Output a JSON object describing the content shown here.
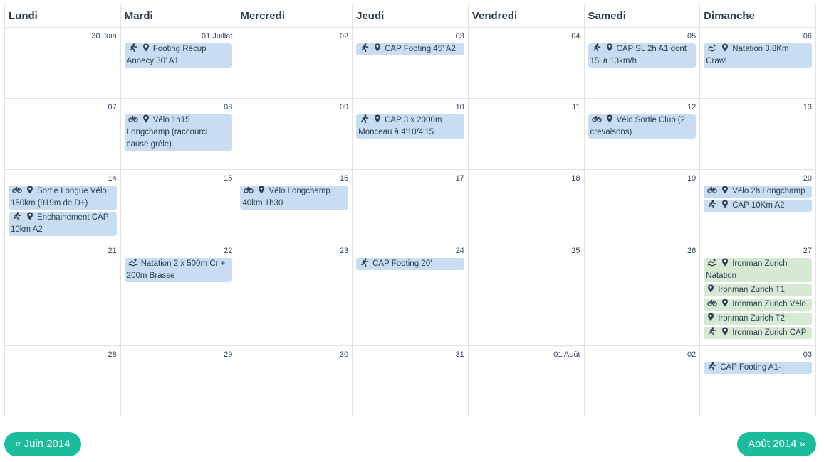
{
  "weekdays": [
    "Lundi",
    "Mardi",
    "Mercredi",
    "Jeudi",
    "Vendredi",
    "Samedi",
    "Dimanche"
  ],
  "weeks": [
    {
      "height": 100,
      "days": [
        {
          "num": "30 Juin",
          "events": []
        },
        {
          "num": "01 Juillet",
          "events": [
            {
              "icon": "run",
              "pin": true,
              "text": "Footing Récup Annecy 30' A1"
            }
          ]
        },
        {
          "num": "02",
          "events": []
        },
        {
          "num": "03",
          "events": [
            {
              "icon": "run",
              "pin": true,
              "text": "CAP Footing 45' A2"
            }
          ]
        },
        {
          "num": "04",
          "events": []
        },
        {
          "num": "05",
          "events": [
            {
              "icon": "run",
              "pin": true,
              "text": "CAP SL 2h A1 dont 15' à 13km/h"
            }
          ]
        },
        {
          "num": "06",
          "events": [
            {
              "icon": "swim",
              "pin": true,
              "text": "Natation 3,8Km Crawl"
            }
          ]
        }
      ]
    },
    {
      "height": 100,
      "days": [
        {
          "num": "07",
          "events": []
        },
        {
          "num": "08",
          "events": [
            {
              "icon": "bike",
              "pin": true,
              "text": "Vélo 1h15 Longchamp (raccourci cause grêle)"
            }
          ]
        },
        {
          "num": "09",
          "events": []
        },
        {
          "num": "10",
          "events": [
            {
              "icon": "run",
              "pin": true,
              "text": "CAP 3 x 2000m Monceau à 4'10/4'15"
            }
          ]
        },
        {
          "num": "11",
          "events": []
        },
        {
          "num": "12",
          "events": [
            {
              "icon": "bike",
              "pin": true,
              "text": "Vélo Sortie Club (2 crevaisons)"
            }
          ]
        },
        {
          "num": "13",
          "events": []
        }
      ]
    },
    {
      "height": 102,
      "days": [
        {
          "num": "14",
          "events": [
            {
              "icon": "bike",
              "pin": true,
              "text": "Sortie Longue Vélo 150km (919m de D+)"
            },
            {
              "icon": "run",
              "pin": true,
              "text": "Enchainement CAP 10km A2"
            }
          ]
        },
        {
          "num": "15",
          "events": []
        },
        {
          "num": "16",
          "events": [
            {
              "icon": "bike",
              "pin": true,
              "text": "Vélo Longchamp 40km 1h30"
            }
          ]
        },
        {
          "num": "17",
          "events": []
        },
        {
          "num": "18",
          "events": []
        },
        {
          "num": "19",
          "events": []
        },
        {
          "num": "20",
          "events": [
            {
              "icon": "bike",
              "pin": true,
              "text": "Vélo 2h Longchamp"
            },
            {
              "icon": "run",
              "pin": true,
              "text": "CAP 10Km A2"
            }
          ]
        }
      ]
    },
    {
      "height": 146,
      "days": [
        {
          "num": "21",
          "events": []
        },
        {
          "num": "22",
          "events": [
            {
              "icon": "swim",
              "pin": false,
              "text": "Natation 2 x 500m Cr + 200m Brasse"
            }
          ]
        },
        {
          "num": "23",
          "events": []
        },
        {
          "num": "24",
          "events": [
            {
              "icon": "run",
              "pin": false,
              "text": "CAP Footing 20'"
            }
          ]
        },
        {
          "num": "25",
          "events": []
        },
        {
          "num": "26",
          "events": []
        },
        {
          "num": "27",
          "events": [
            {
              "icon": "swim",
              "pin": true,
              "text": "Ironman Zurich Natation",
              "green": true
            },
            {
              "icon": "",
              "pin": true,
              "text": "Ironman Zurich T1",
              "green": true
            },
            {
              "icon": "bike",
              "pin": true,
              "text": "Ironman Zurich Vélo",
              "green": true
            },
            {
              "icon": "",
              "pin": true,
              "text": "Ironman Zurich T2",
              "green": true
            },
            {
              "icon": "run",
              "pin": true,
              "text": "Ironman Zurich CAP",
              "green": true
            }
          ]
        }
      ]
    },
    {
      "height": 100,
      "days": [
        {
          "num": "28",
          "events": []
        },
        {
          "num": "29",
          "events": []
        },
        {
          "num": "30",
          "events": []
        },
        {
          "num": "31",
          "events": []
        },
        {
          "num": "01 Août",
          "events": []
        },
        {
          "num": "02",
          "events": []
        },
        {
          "num": "03",
          "events": [
            {
              "icon": "run",
              "pin": false,
              "text": "CAP Footing A1-"
            }
          ]
        }
      ]
    }
  ],
  "nav": {
    "prev": "« Juin 2014",
    "next": "Août 2014 »"
  },
  "colors": {
    "event_blue": "#c9ddf2",
    "event_green": "#d6ead3",
    "button": "#1abc9c"
  }
}
